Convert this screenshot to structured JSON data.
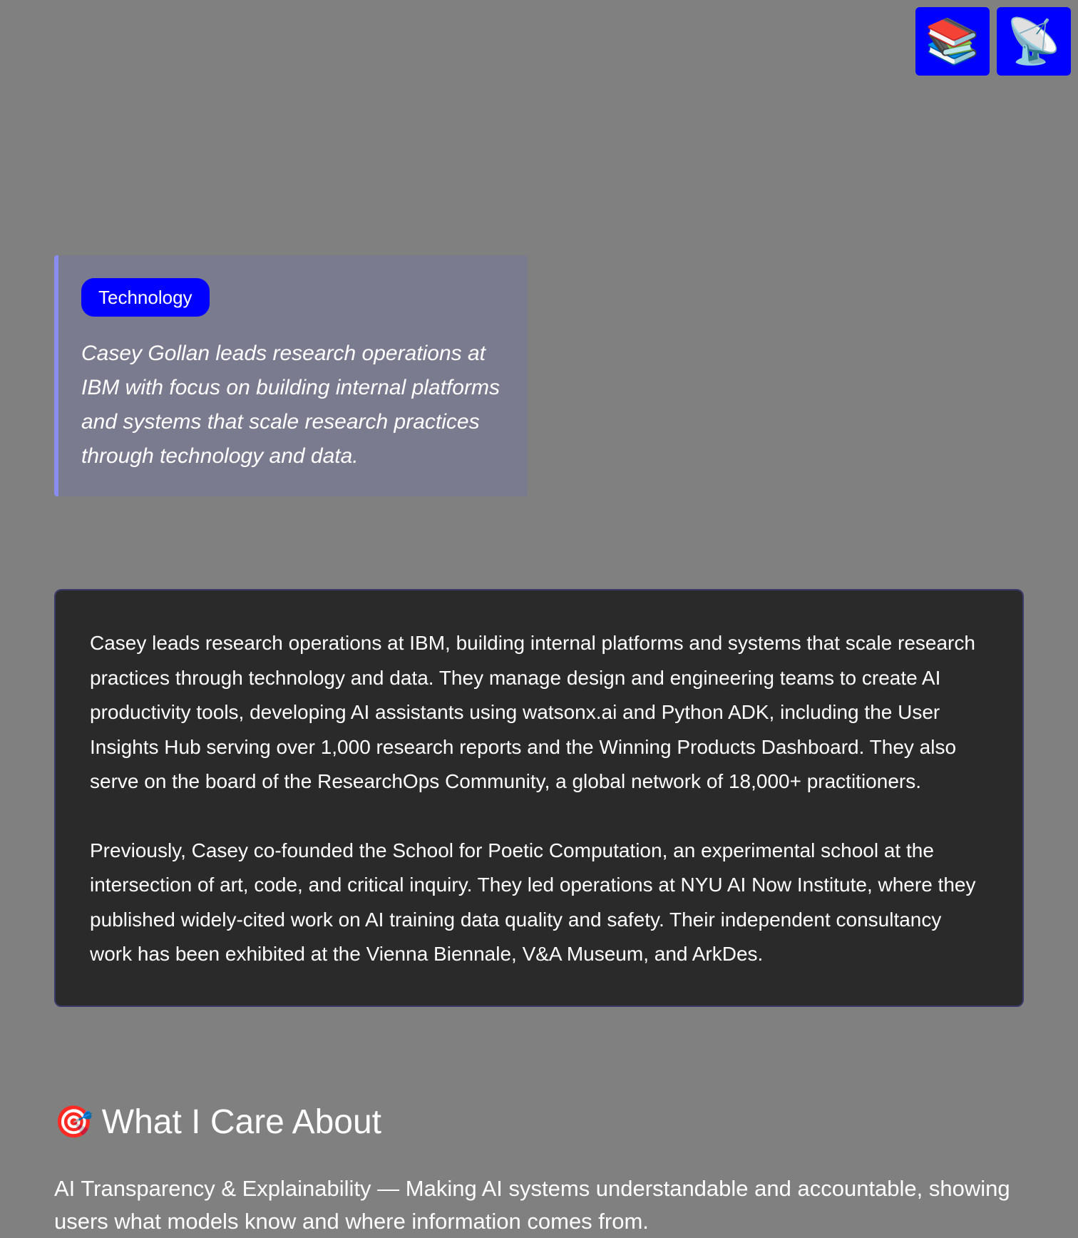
{
  "toolbar": {
    "books_icon": "📚",
    "satellite_icon": "📡"
  },
  "intro": {
    "tag": "Technology",
    "summary": "Casey Gollan leads research operations at IBM with focus on building internal platforms and systems that scale research practices through technology and data."
  },
  "bio": {
    "paragraphs": [
      "Casey leads research operations at IBM, building internal platforms and systems that scale research practices through technology and data. They manage design and engineering teams to create AI productivity tools, developing AI assistants using watsonx.ai and Python ADK, including the User Insights Hub serving over 1,000 research reports and the Winning Products Dashboard. They also serve on the board of the ResearchOps Community, a global network of 18,000+ practitioners.",
      "Previously, Casey co-founded the School for Poetic Computation, an experimental school at the intersection of art, code, and critical inquiry. They led operations at NYU AI Now Institute, where they published widely-cited work on AI training data quality and safety. Their independent consultancy work has been exhibited at the Vienna Biennale, V&A Museum, and ArkDes."
    ]
  },
  "care": {
    "emoji": "🎯",
    "title": "What I Care About",
    "items": [
      "AI Transparency & Explainability — Making AI systems understandable and accountable, showing users what models know and where information comes from."
    ]
  },
  "colors": {
    "page_background": "#808080",
    "accent_blue": "#0000ff",
    "intro_card": "#7b7b90",
    "intro_border": "#8a8cf0",
    "bio_card": "#2a2a2b"
  }
}
